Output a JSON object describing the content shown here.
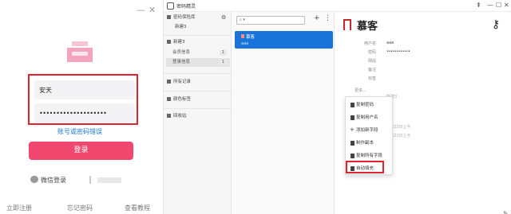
{
  "login": {
    "username": "安天",
    "password_mask": "••••••••••••••••••••",
    "error_link": "账号或密码错误",
    "login_button": "登录",
    "wechat_login": "微信登录",
    "register": "立即注册",
    "forgot": "忘记密码",
    "tutorial": "查看教程",
    "minimize": "—",
    "close": "✕"
  },
  "app": {
    "title": "密码精灵",
    "pin": "⇞",
    "minimize": "—",
    "maximize": "☐",
    "close": "✕"
  },
  "nav": {
    "vault": "密码保险库",
    "new_top": "新建3",
    "group": "新建3",
    "sub_items": [
      {
        "label": "会员信息",
        "count": "1"
      },
      {
        "label": "登录信息",
        "count": "1"
      }
    ],
    "all_records": "所有记录",
    "color_tags": "颜色标签",
    "recycle_bin": "回收站"
  },
  "list": {
    "search_placeholder": "▾",
    "add": "+",
    "menu": "⋮",
    "entry_title": "慕客",
    "entry_sub": "aaa"
  },
  "detail": {
    "title": "慕客",
    "fields": [
      {
        "label": "用户名",
        "value": "aaa"
      },
      {
        "label": "密码",
        "value": "••••••••••••"
      },
      {
        "label": "网站",
        "value": ""
      },
      {
        "label": "备注",
        "value": ""
      },
      {
        "label": "标签",
        "value": ""
      }
    ],
    "more": "更多...",
    "faint_1": "新建3",
    "faint_2": "年8月22日上午",
    "faint_3": "年8月22日上午"
  },
  "context_menu": {
    "items": [
      {
        "icon": "copy-icon",
        "label": "复制密码"
      },
      {
        "icon": "copy-icon",
        "label": "复制用户名"
      },
      {
        "icon": "plus-icon",
        "label": "添加新字段"
      },
      {
        "icon": "copy-icon",
        "label": "制作副本"
      },
      {
        "icon": "copy-icon",
        "label": "复制所有字段"
      },
      {
        "icon": "autofill-icon",
        "label": "自动填充"
      }
    ]
  },
  "colors": {
    "accent_red": "#e0232e",
    "login_pink": "#f2476f",
    "selection_blue": "#1a73d9"
  }
}
